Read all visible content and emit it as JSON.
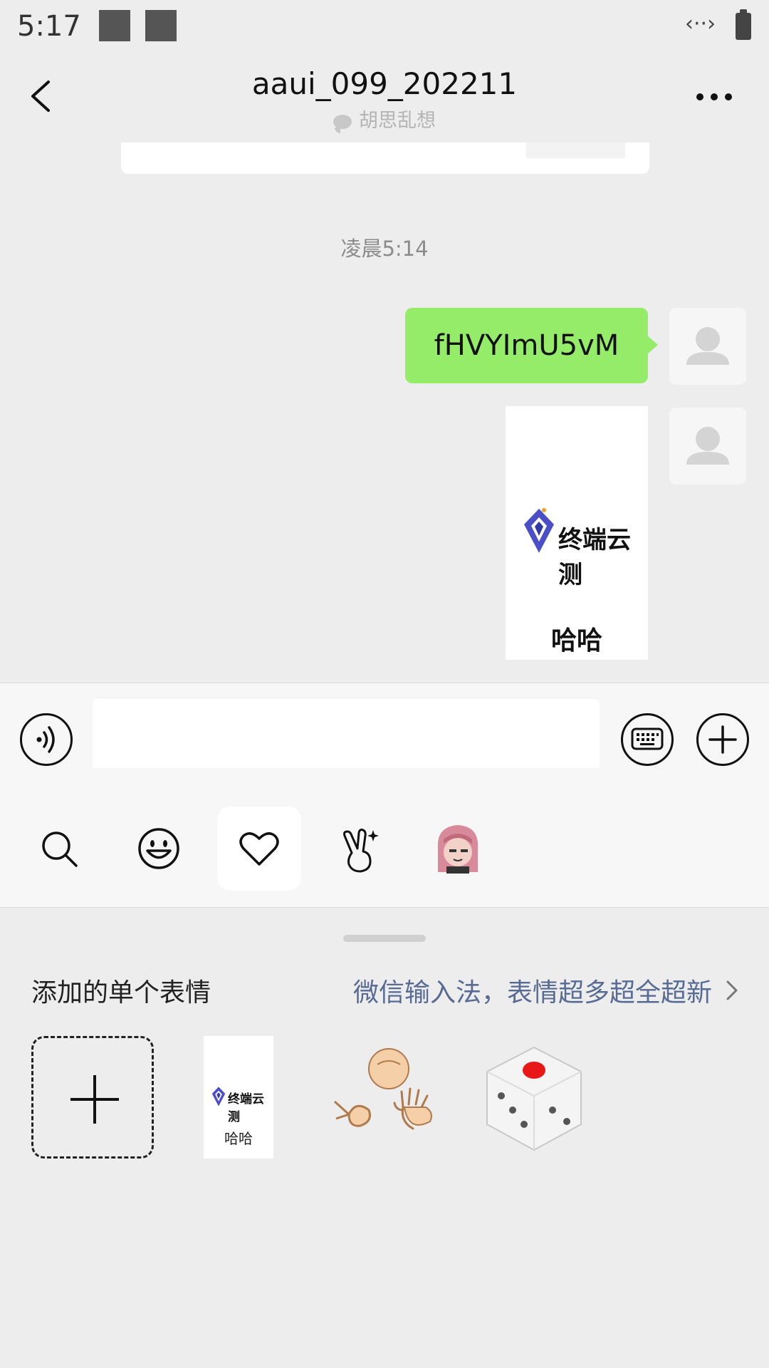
{
  "status_bar": {
    "time": "5:17",
    "link_icon_text": "‹··›"
  },
  "header": {
    "title": "aaui_099_202211",
    "subtitle": "胡思乱想"
  },
  "chat": {
    "timestamp": "凌晨5:14",
    "messages": [
      {
        "type": "text",
        "text": "fHVYImU5vM"
      },
      {
        "type": "sticker",
        "brand_text": "终端云测",
        "caption": "哈哈"
      }
    ]
  },
  "input": {
    "value": "",
    "placeholder": ""
  },
  "emoji_tabs": [
    {
      "icon": "search-icon"
    },
    {
      "icon": "smiley-icon"
    },
    {
      "icon": "heart-icon",
      "active": true
    },
    {
      "icon": "hand-gesture-icon"
    },
    {
      "icon": "anime-character-icon"
    }
  ],
  "panel": {
    "title": "添加的单个表情",
    "promo": "微信输入法，表情超多超全超新",
    "stickers": [
      {
        "icon": "add-icon"
      },
      {
        "icon": "brand-sticker",
        "brand_text": "终端云测",
        "caption": "哈哈"
      },
      {
        "icon": "rock-paper-scissors-icon"
      },
      {
        "icon": "dice-icon"
      }
    ]
  },
  "colors": {
    "bubble_green": "#95ec69",
    "link_blue": "#576b95",
    "background": "#ededed"
  }
}
